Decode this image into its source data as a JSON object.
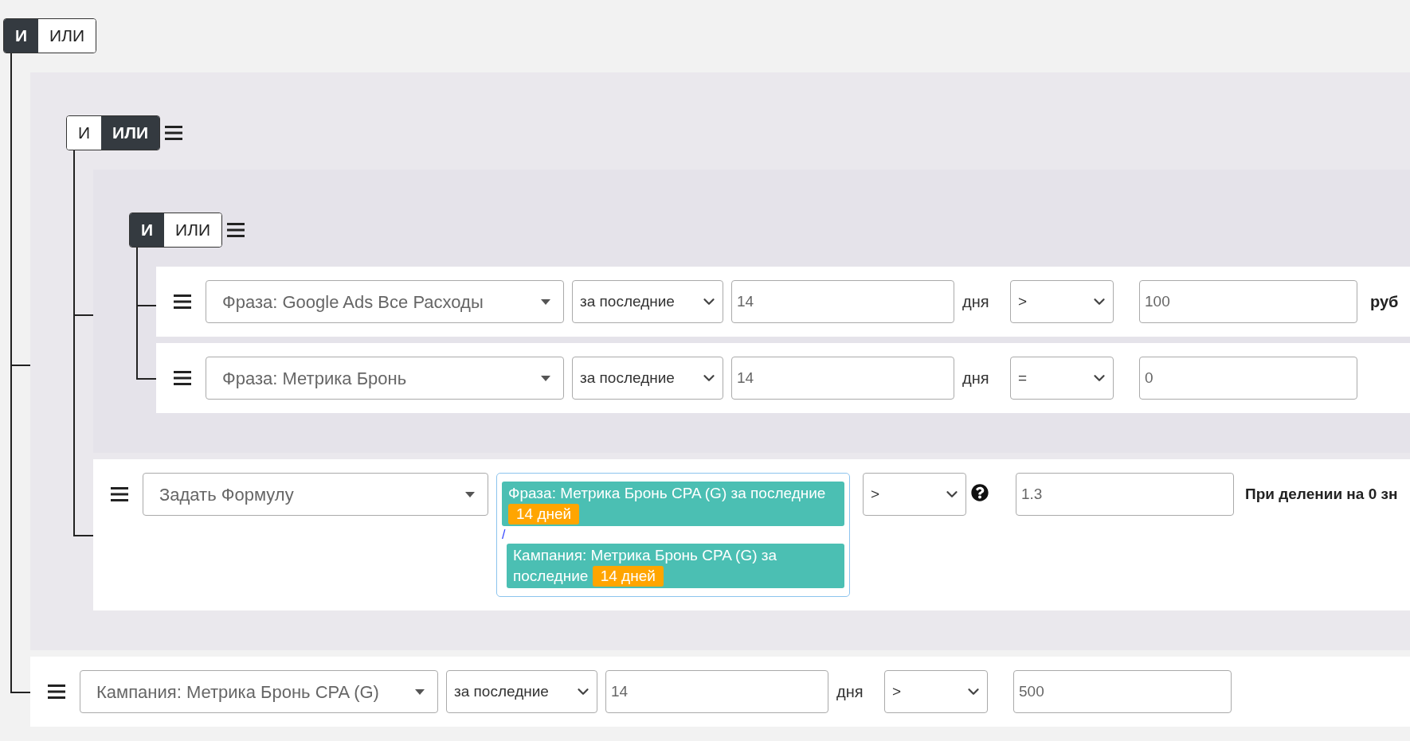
{
  "root": {
    "kind": "root",
    "toggle": [
      {
        "label": "И",
        "selected": true
      },
      {
        "label": "ИЛИ",
        "selected": false
      }
    ],
    "children": [
      {
        "kind": "group",
        "toggle": [
          {
            "label": "И",
            "selected": false
          },
          {
            "label": "ИЛИ",
            "selected": true
          }
        ],
        "children": [
          {
            "kind": "group",
            "toggle": [
              {
                "label": "И",
                "selected": true
              },
              {
                "label": "ИЛИ",
                "selected": false
              }
            ],
            "children": [
              {
                "kind": "rule",
                "field": "Фраза: Google Ads Все Расходы",
                "period": "за последние",
                "days": "14",
                "days_unit": "дня",
                "operator": ">",
                "value": "100",
                "unit": "руб"
              },
              {
                "kind": "rule",
                "field": "Фраза: Метрика Бронь",
                "period": "за последние",
                "days": "14",
                "days_unit": "дня",
                "operator": "=",
                "value": "0"
              }
            ]
          },
          {
            "kind": "formula",
            "field": "Задать Формулу",
            "terms": [
              {
                "text": "Фраза: Метрика Бронь CPA (G) за последние",
                "badge": "14 дней"
              },
              {
                "text": "Кампания: Метрика Бронь CPA (G) за последние",
                "badge": "14 дней"
              }
            ],
            "separator": "/",
            "operator": ">",
            "value": "1.3",
            "note": "При делении на 0 зн"
          }
        ]
      },
      {
        "kind": "rule",
        "field": "Кампания: Метрика Бронь CPA (G)",
        "period": "за последние",
        "days": "14",
        "days_unit": "дня",
        "operator": ">",
        "value": "500"
      }
    ]
  }
}
